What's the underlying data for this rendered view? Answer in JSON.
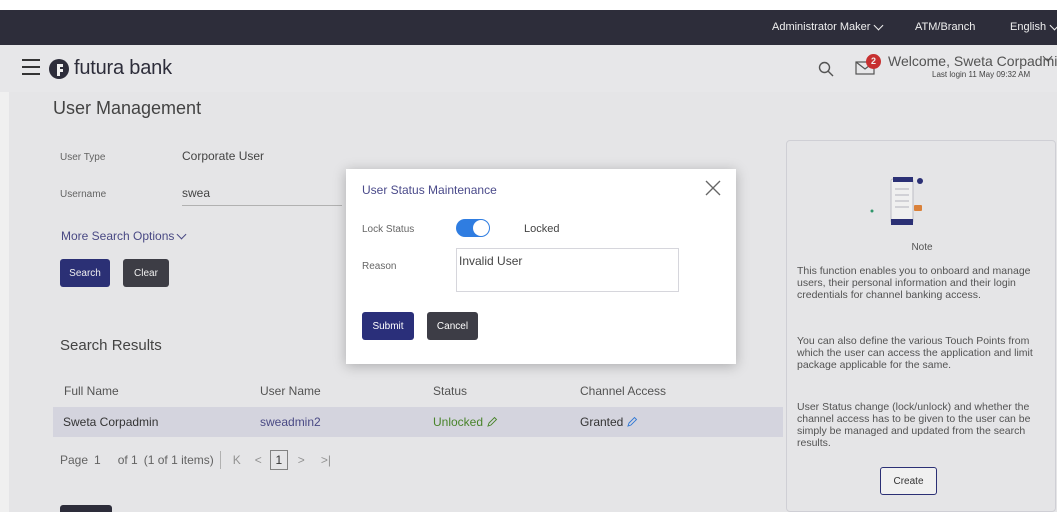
{
  "topbar": {
    "role": "Administrator Maker",
    "location": "ATM/Branch",
    "language": "English"
  },
  "header": {
    "brand": "futura bank",
    "notification_count": "2",
    "welcome": "Welcome, Sweta Corpadmin",
    "last_login": "Last login 11 May 09:32 AM"
  },
  "page": {
    "title": "User Management"
  },
  "search": {
    "user_type_label": "User Type",
    "user_type_value": "Corporate User",
    "username_label": "Username",
    "username_value": "swea",
    "more_options": "More Search Options",
    "search_button": "Search",
    "clear_button": "Clear"
  },
  "results": {
    "title": "Search Results",
    "columns": [
      "Full Name",
      "User Name",
      "Status",
      "Channel Access"
    ],
    "rows": [
      {
        "full_name": "Sweta Corpadmin",
        "user_name": "sweadmin2",
        "status": "Unlocked",
        "channel_access": "Granted"
      }
    ],
    "pager": {
      "page_label": "Page",
      "page_value": "1",
      "of_text": "of 1",
      "items_text": "(1 of 1 items)",
      "current_page": "1"
    }
  },
  "note": {
    "title": "Note",
    "paragraphs": [
      "This function enables you to onboard and manage users, their personal information and their login credentials for channel banking access.",
      "You can also define the various Touch Points from which the user can access the application and limit package applicable for the same.",
      "User Status change (lock/unlock) and whether the channel access has to be given to the user can be simply be managed and updated from the search results."
    ],
    "create_button": "Create"
  },
  "modal": {
    "title": "User Status Maintenance",
    "lock_status_label": "Lock Status",
    "lock_state": "Locked",
    "reason_label": "Reason",
    "reason_value": "Invalid User",
    "submit_button": "Submit",
    "cancel_button": "Cancel"
  },
  "colors": {
    "topbar_bg": "#2c2c3a",
    "primary": "#2a2f7a",
    "toggle_on": "#2f7de1",
    "link": "#4a4a8a",
    "status_green": "#4a8a2a",
    "badge_red": "#d32f2f"
  }
}
